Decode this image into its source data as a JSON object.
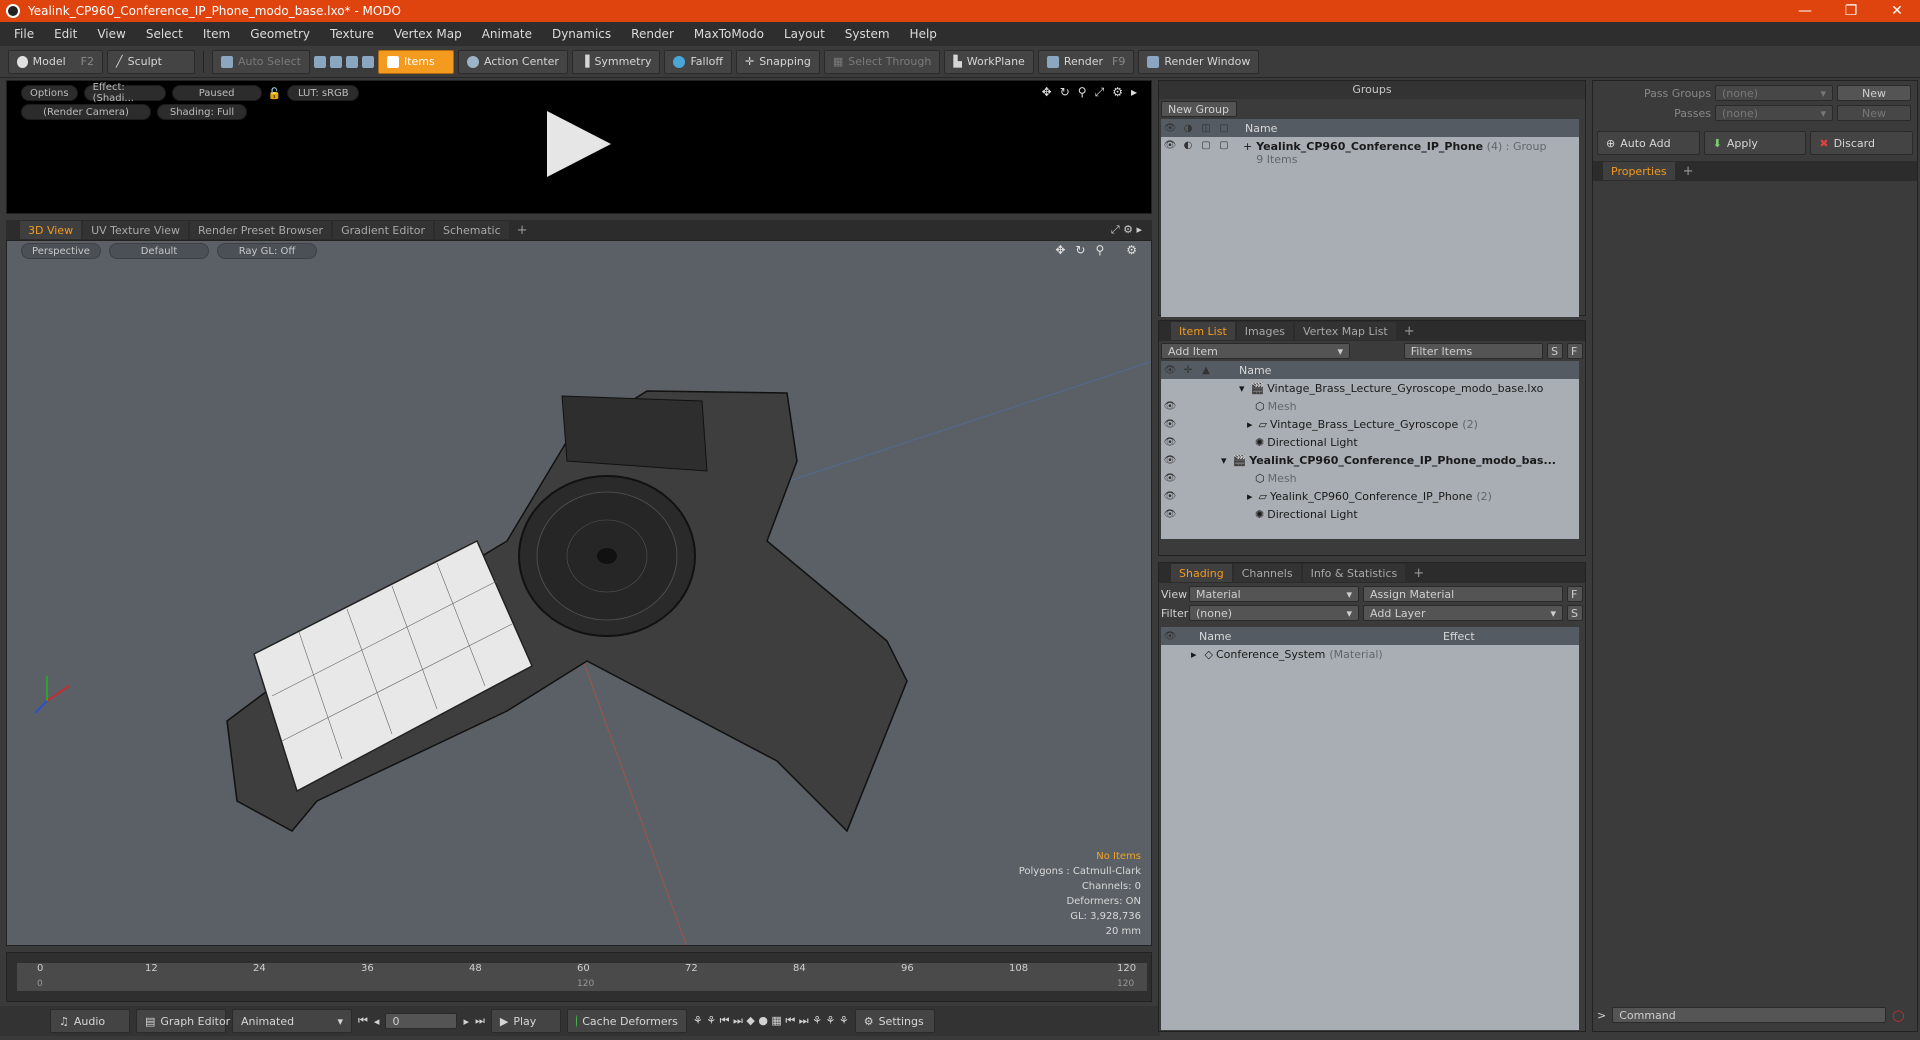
{
  "window": {
    "title": "Yealink_CP960_Conference_IP_Phone_modo_base.lxo* - MODO",
    "minimize": "—",
    "maximize": "❐",
    "close": "✕"
  },
  "menu": [
    "File",
    "Edit",
    "View",
    "Select",
    "Item",
    "Geometry",
    "Texture",
    "Vertex Map",
    "Animate",
    "Dynamics",
    "Render",
    "MaxToModo",
    "Layout",
    "System",
    "Help"
  ],
  "toolbar": {
    "model": "Model",
    "model_key": "F2",
    "sculpt": "Sculpt",
    "auto_select": "Auto Select",
    "items": "Items",
    "action_center": "Action Center",
    "symmetry": "Symmetry",
    "falloff": "Falloff",
    "snapping": "Snapping",
    "select_through": "Select Through",
    "workplane": "WorkPlane",
    "render": "Render",
    "render_key": "F9",
    "render_window": "Render Window"
  },
  "preview": {
    "options": "Options",
    "effect": "Effect: (Shadi...",
    "paused": "Paused",
    "lut": "LUT: sRGB",
    "camera": "(Render Camera)",
    "shading": "Shading: Full"
  },
  "view_tabs": [
    "3D View",
    "UV Texture View",
    "Render Preset Browser",
    "Gradient Editor",
    "Schematic"
  ],
  "viewport": {
    "perspective": "Perspective",
    "default": "Default",
    "raygl": "Ray GL: Off",
    "stats": {
      "no_items": "No Items",
      "polygons": "Polygons : Catmull-Clark",
      "channels": "Channels: 0",
      "deformers": "Deformers: ON",
      "gl": "GL: 3,928,736",
      "mm": "20 mm"
    }
  },
  "timeline": {
    "ticks": [
      "0",
      "12",
      "24",
      "36",
      "48",
      "60",
      "72",
      "84",
      "96",
      "108",
      "120"
    ],
    "sub_left": "0",
    "sub_mid": "120",
    "sub_right": "120"
  },
  "transport": {
    "audio": "Audio",
    "graph_editor": "Graph Editor",
    "animated": "Animated",
    "frame": "0",
    "play": "Play",
    "cache": "Cache Deformers",
    "settings": "Settings"
  },
  "groups": {
    "title": "Groups",
    "new_group": "New Group",
    "name_col": "Name",
    "item_name": "Yealink_CP960_Conference_IP_Phone",
    "item_count": "(4)",
    "item_type": ": Group",
    "item_sub": "9 Items"
  },
  "itemlist": {
    "tabs": [
      "Item List",
      "Images",
      "Vertex Map List"
    ],
    "add_item": "Add Item",
    "filter": "Filter Items",
    "s": "S",
    "f": "F",
    "name_col": "Name",
    "rows": [
      {
        "label": "Vintage_Brass_Lecture_Gyroscope_modo_base.lxo",
        "extra": ""
      },
      {
        "label": "Mesh",
        "extra": ""
      },
      {
        "label": "Vintage_Brass_Lecture_Gyroscope",
        "extra": "(2)"
      },
      {
        "label": "Directional Light",
        "extra": ""
      },
      {
        "label": "Yealink_CP960_Conference_IP_Phone_modo_bas...",
        "extra": ""
      },
      {
        "label": "Mesh",
        "extra": ""
      },
      {
        "label": "Yealink_CP960_Conference_IP_Phone",
        "extra": "(2)"
      },
      {
        "label": "Directional Light",
        "extra": ""
      }
    ]
  },
  "shading": {
    "tabs": [
      "Shading",
      "Channels",
      "Info & Statistics"
    ],
    "view_label": "View",
    "view_value": "Material",
    "assign": "Assign Material",
    "filter_label": "Filter",
    "filter_value": "(none)",
    "add_layer": "Add Layer",
    "f": "F",
    "s": "S",
    "name_col": "Name",
    "effect_col": "Effect",
    "row": "Conference_System",
    "row_type": "(Material)"
  },
  "props": {
    "pass_groups": "Pass Groups",
    "passes": "Passes",
    "none": "(none)",
    "new": "New",
    "auto_add": "Auto Add",
    "apply": "Apply",
    "discard": "Discard",
    "properties": "Properties",
    "command": "Command"
  }
}
